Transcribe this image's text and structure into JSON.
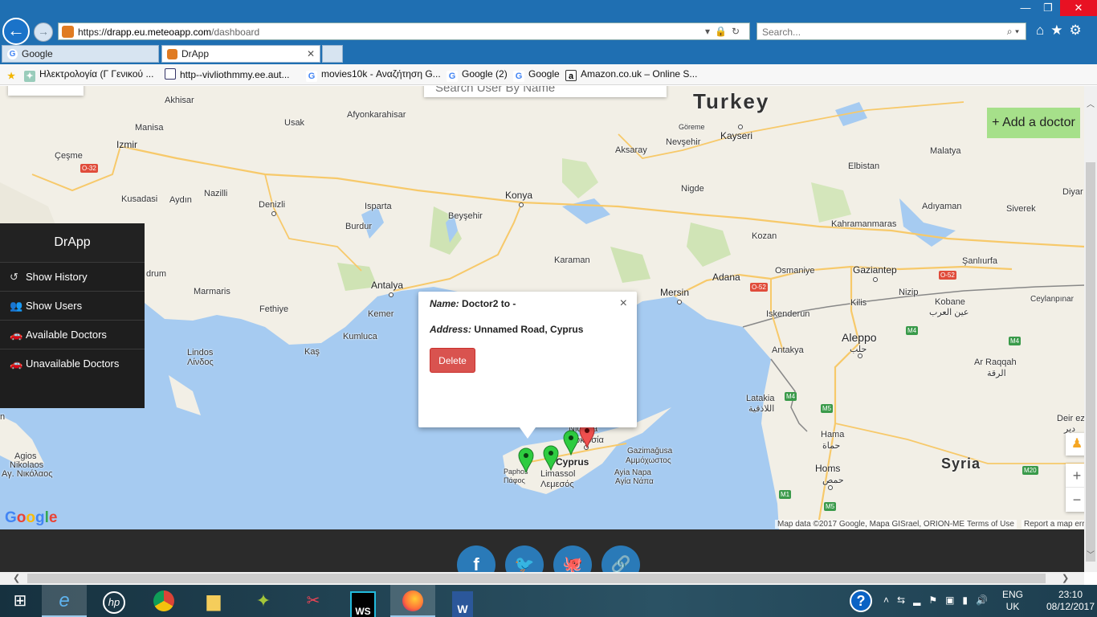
{
  "browser": {
    "url_scheme": "https://",
    "url_host": "drapp.eu.meteoapp.com",
    "url_path": "/dashboard",
    "search_placeholder": "Search...",
    "window_controls": {
      "minimize": "—",
      "restore": "❐",
      "close": "✕"
    },
    "tabs": [
      {
        "label": "Google",
        "icon": "google-g-icon"
      },
      {
        "label": "DrApp",
        "icon": "drapp-favicon",
        "active": true
      }
    ],
    "favorites": [
      {
        "label": "Ηλεκτρολογία (Γ Γενικού ..."
      },
      {
        "label": "http--vivliothmmy.ee.aut..."
      },
      {
        "label": "movies10k - Αναζήτηση G..."
      },
      {
        "label": "Google (2)"
      },
      {
        "label": "Google"
      },
      {
        "label": "Amazon.co.uk – Online S..."
      }
    ]
  },
  "map": {
    "search_placeholder": "Search User By Name",
    "add_doctor_label": "+ Add a doctor",
    "labels": {
      "turkey": "Turkey",
      "cyprus": "Cyprus",
      "syria": "Syria",
      "akhisar": "Akhisar",
      "usak": "Usak",
      "afyon": "Afyonkarahisar",
      "manisa": "Manisa",
      "izmir": "Izmir",
      "cesme": "Çeşme",
      "kusadasi": "Kusadasi",
      "aydin": "Aydın",
      "nazilli": "Nazilli",
      "denizli": "Denizli",
      "isparta": "Isparta",
      "beysehir": "Beyşehir",
      "burdur": "Burdur",
      "konya": "Konya",
      "aksaray": "Aksaray",
      "goreme": "Göreme",
      "nevsehir": "Nevşehir",
      "kayseri": "Kayseri",
      "nigde": "Nigde",
      "karaman": "Karaman",
      "antalya": "Antalya",
      "marmaris": "Marmaris",
      "fethiye": "Fethiye",
      "kemer": "Kemer",
      "kumluca": "Kumluca",
      "kas": "Kaş",
      "lindos": "Lindos",
      "lindos_gr": "Λίνδος",
      "bodrum": "drum",
      "mersin": "Mersin",
      "adana": "Adana",
      "kozan": "Kozan",
      "osmaniye": "Osmaniye",
      "gaziantep": "Gaziantep",
      "kahramanmaras": "Kahramanmaras",
      "adiyaman": "Adıyaman",
      "siverek": "Siverek",
      "sanliurfa": "Şanlıurfa",
      "malatya": "Malatya",
      "elbistan": "Elbistan",
      "diyar": "Diyar",
      "iskenderun": "Iskenderun",
      "antakya": "Antakya",
      "kilis": "Kilis",
      "nizip": "Nizip",
      "kobane": "Kobane",
      "kobane_ar": "عين العرب",
      "ceylanpinar": "Ceylanpınar",
      "aleppo": "Aleppo",
      "aleppo_ar": "حلب",
      "arraqqah": "Ar Raqqah",
      "arraqqah_ar": "الرقة",
      "latakia": "Latakia",
      "latakia_ar": "اللاذقية",
      "hama": "Hama",
      "hama_ar": "حماة",
      "homs": "Homs",
      "homs_ar": "حمص",
      "deirez": "Deir ez",
      "deir2": "دير",
      "nicosia": "Nicosia",
      "nicosia_gr": "Λευκωσία",
      "gazimagusa": "Gazimağusa",
      "gazimagusa_gr": "Αμμόχωστος",
      "limassol": "Limassol",
      "limassol_gr": "Λεμεσός",
      "paphos": "Paphos",
      "paphos_gr": "Πάφος",
      "ayianapa": "Ayia Napa",
      "ayianapa_gr": "Αγία Νάπα",
      "agios": "Agios",
      "nikolaos": "Nikolaos",
      "nikolaos_gr": "Αγ. Νικόλαος",
      "n_edge": "n"
    },
    "roads": {
      "o32": "O-32",
      "o52a": "O-52",
      "o52b": "O-52",
      "m4a": "M4",
      "m4b": "M4",
      "m5a": "M5",
      "m5b": "M5",
      "m1": "M1",
      "m20": "M20"
    },
    "attribution": "Map data ©2017 Google, Mapa GISrael, ORION-ME",
    "terms": "Terms of Use",
    "report": "Report a map erro",
    "logo": "Google",
    "zoom_in": "+",
    "zoom_out": "−"
  },
  "sidebar": {
    "title": "DrApp",
    "items": [
      {
        "label": "Show History",
        "icon": "history-icon"
      },
      {
        "label": "Show Users",
        "icon": "users-icon"
      },
      {
        "label": "Available Doctors",
        "icon": "car-icon"
      },
      {
        "label": "Unavailable Doctors",
        "icon": "car-icon"
      }
    ]
  },
  "infowindow": {
    "name_label": "Name:",
    "name_value": "Doctor2 to -",
    "address_label": "Address:",
    "address_value": "Unnamed Road, Cyprus",
    "delete_label": "Delete",
    "close": "×"
  },
  "markers": [
    {
      "color": "#2ecc40",
      "status": "available"
    },
    {
      "color": "#2ecc40",
      "status": "available"
    },
    {
      "color": "#2ecc40",
      "status": "available"
    },
    {
      "color": "#f0504f",
      "status": "unavailable"
    }
  ],
  "footer": {
    "social": [
      {
        "name": "facebook",
        "glyph": "f"
      },
      {
        "name": "twitter",
        "glyph": "🐦"
      },
      {
        "name": "github",
        "glyph": "🐙"
      },
      {
        "name": "link",
        "glyph": "🔗"
      }
    ]
  },
  "taskbar": {
    "lang_top": "ENG",
    "lang_bottom": "UK",
    "time": "23:10",
    "date": "08/12/2017",
    "apps": [
      "ie",
      "hp",
      "chrome",
      "explorer",
      "android-studio",
      "snipping",
      "webstorm",
      "firefox",
      "word"
    ]
  }
}
